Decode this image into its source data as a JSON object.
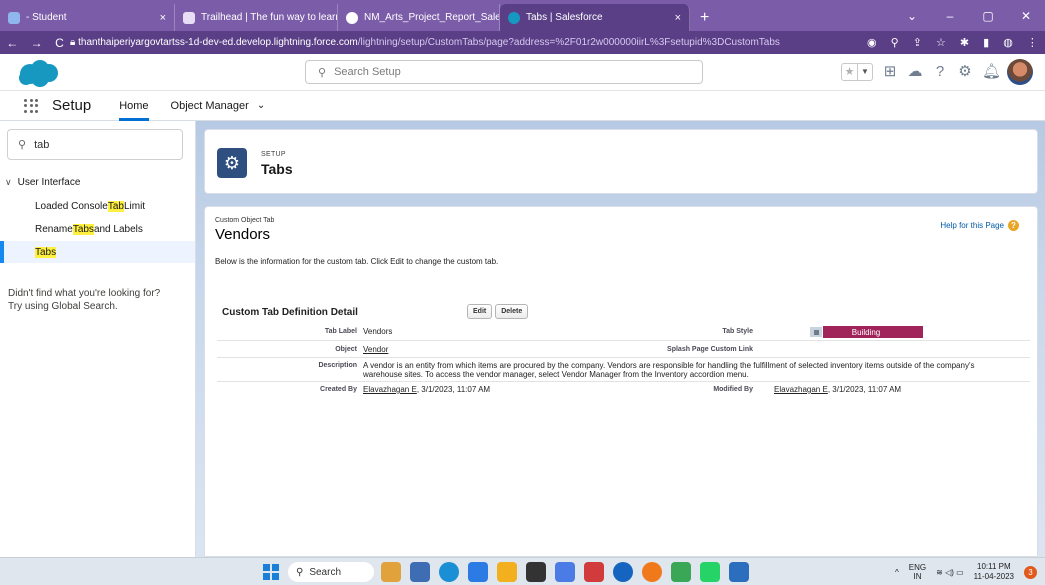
{
  "browser": {
    "tabs": [
      {
        "title": "- Student",
        "close": "×"
      },
      {
        "title": "Trailhead | The fun way to learn",
        "close": "×"
      },
      {
        "title": "NM_Arts_Project_Report_Salesfor",
        "close": "×"
      },
      {
        "title": "Tabs | Salesforce",
        "close": "×"
      }
    ],
    "new_tab": "+",
    "window_controls": [
      "⌄",
      "–",
      "▢",
      "✕"
    ],
    "url_host": "thanthaiperiyargovtartss-1d-dev-ed.develop.lightning.force.com",
    "url_path": "/lightning/setup/CustomTabs/page?address=%2F01r2w000000iirL%3Fsetupid%3DCustomTabs",
    "nav_buttons": [
      "←",
      "→",
      "C"
    ],
    "toolbar_icons": [
      "google-icon",
      "zoom-icon",
      "share-icon",
      "star-icon",
      "extensions-icon",
      "sidebar-icon",
      "profile-icon",
      "menu-icon"
    ]
  },
  "sf_header": {
    "search_placeholder": "Search Setup"
  },
  "setup_nav": {
    "title": "Setup",
    "home": "Home",
    "object_manager": "Object Manager",
    "chevron": "⌄"
  },
  "sidebar": {
    "search_value": "tab",
    "group": "User Interface",
    "items": [
      {
        "before": "Loaded Console ",
        "hl": "Tab",
        "after": " Limit"
      },
      {
        "before": "Rename ",
        "hl": "Tabs",
        "after": " and Labels"
      },
      {
        "before": "",
        "hl": "Tabs",
        "after": ""
      }
    ],
    "help_line1": "Didn't find what you're looking for?",
    "help_line2": "Try using Global Search."
  },
  "page_header": {
    "eyebrow": "SETUP",
    "title": "Tabs"
  },
  "content": {
    "type_label": "Custom Object Tab",
    "name": "Vendors",
    "help_link": "Help for this Page",
    "help_icon": "?",
    "description": "Below is the information for the custom tab. Click Edit to change the custom tab.",
    "section_title": "Custom Tab Definition Detail",
    "edit_button": "Edit",
    "delete_button": "Delete",
    "fields": {
      "tab_label_label": "Tab Label",
      "tab_label_value": "Vendors",
      "tab_style_label": "Tab Style",
      "tab_style_value": "Building",
      "object_label": "Object",
      "object_value": "Vendor",
      "splash_label": "Splash Page Custom Link",
      "description_label": "Description",
      "description_value_1": "A vendor is an entity from which items are procured by the company. Vendors are responsible for handling the fulfillment of selected inventory items outside of the company's",
      "description_value_2": "warehouse sites. To access the vendor manager, select Vendor Manager from the Inventory accordion menu.",
      "created_by_label": "Created By",
      "created_by_name": "Elavazhagan E",
      "created_by_date": ", 3/1/2023, 11:07 AM",
      "modified_by_label": "Modified By",
      "modified_by_name": "Elavazhagan E",
      "modified_by_date": ", 3/1/2023, 11:07 AM"
    }
  },
  "taskbar": {
    "search": "Search",
    "app_colors": [
      "#e2a23b",
      "#3f6db3",
      "#1b8fd6",
      "#2c7be5",
      "#f2b01e",
      "#333333",
      "#4b7be5",
      "#d23b3b",
      "#1565c0",
      "#f07a1b",
      "#3aa757",
      "#25d366",
      "#2a6ebd"
    ],
    "lang_1": "ENG",
    "lang_2": "IN",
    "time": "10:11 PM",
    "date": "11-04-2023",
    "notif_count": "3",
    "chevron": "^",
    "wifi_sound_battery": "≋ ◁) ▭"
  }
}
